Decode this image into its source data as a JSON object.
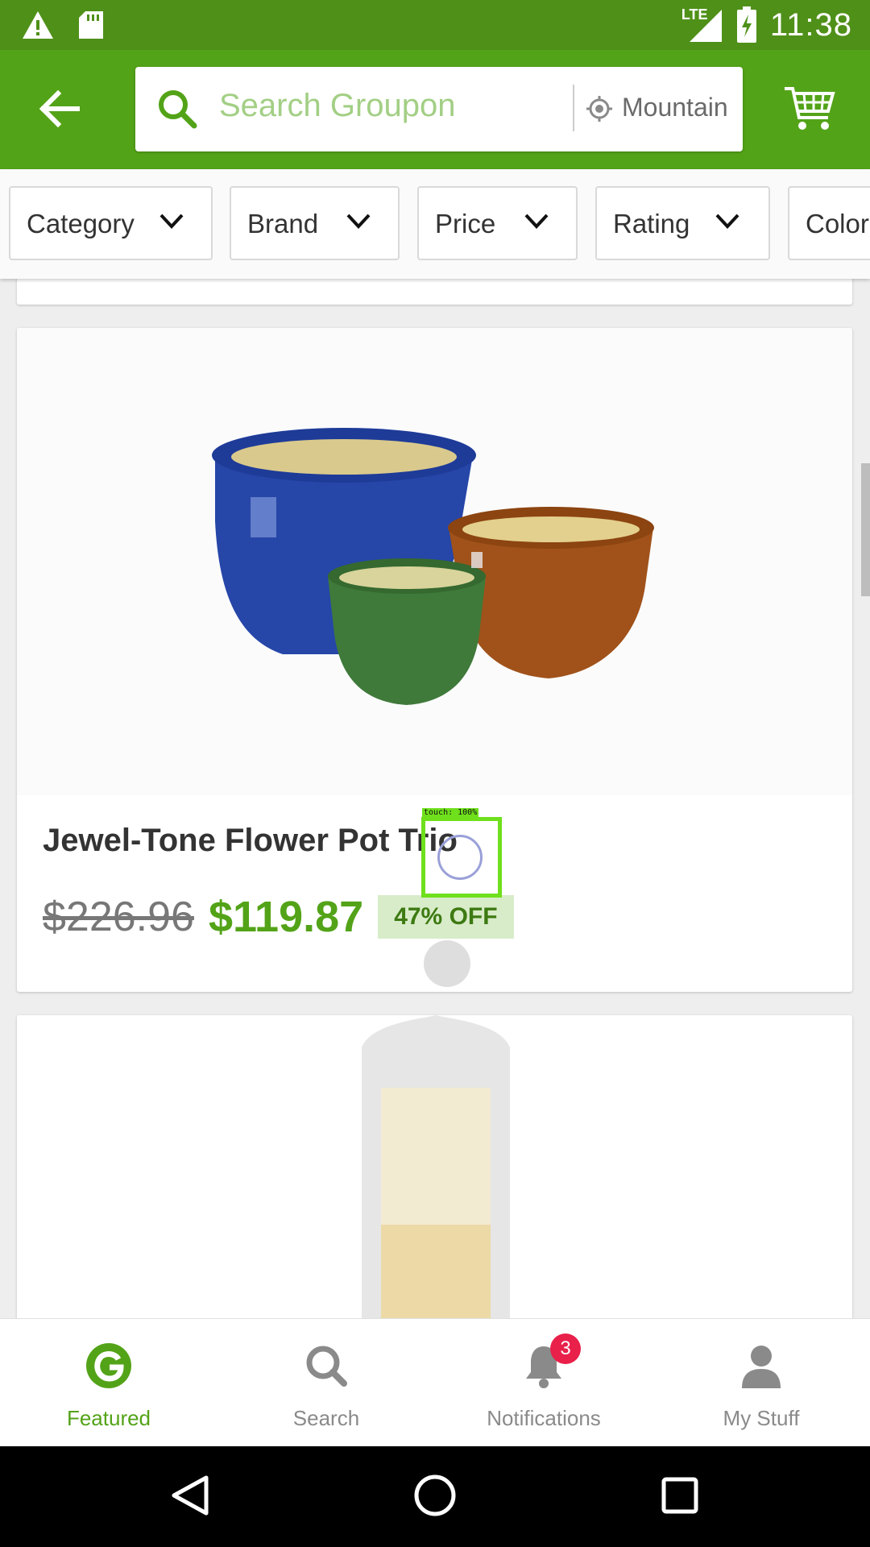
{
  "status_bar": {
    "network": "LTE",
    "time": "11:38"
  },
  "app_bar": {
    "search_placeholder": "Search Groupon",
    "location": "Mountain View"
  },
  "filters": [
    {
      "label": "Category"
    },
    {
      "label": "Brand"
    },
    {
      "label": "Price"
    },
    {
      "label": "Rating"
    },
    {
      "label": "Color"
    }
  ],
  "deal": {
    "title": "Jewel-Tone Flower Pot Trio",
    "original_price": "$226.96",
    "sale_price": "$119.87",
    "discount": "47% OFF"
  },
  "overlay": {
    "touch_label": "touch: 100%"
  },
  "bottom_nav": {
    "items": [
      {
        "label": "Featured",
        "icon": "groupon-g-icon",
        "active": true
      },
      {
        "label": "Search",
        "icon": "search-icon",
        "active": false
      },
      {
        "label": "Notifications",
        "icon": "bell-icon",
        "active": false,
        "badge": "3"
      },
      {
        "label": "My Stuff",
        "icon": "person-icon",
        "active": false
      }
    ]
  },
  "colors": {
    "brand_green": "#53a318",
    "status_green": "#4f9019",
    "badge_red": "#e8204a"
  }
}
